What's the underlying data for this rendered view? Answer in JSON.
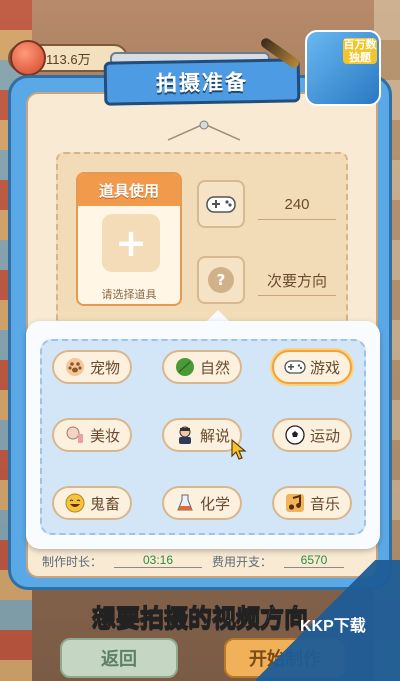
{
  "hud": {
    "coins": "113.6万"
  },
  "dialog": {
    "title": "拍摄准备",
    "item_card": {
      "header": "道具使用",
      "hint": "请选择道具"
    },
    "stats": [
      {
        "icon": "gamepad-icon",
        "value": "240"
      },
      {
        "icon": "question-icon",
        "value": "次要方向"
      }
    ]
  },
  "genres": [
    {
      "label": "宠物",
      "icon": "paw-icon"
    },
    {
      "label": "自然",
      "icon": "leaf-icon"
    },
    {
      "label": "游戏",
      "icon": "gamepad-icon",
      "selected": true
    },
    {
      "label": "美妆",
      "icon": "makeup-icon"
    },
    {
      "label": "解说",
      "icon": "commentator-icon"
    },
    {
      "label": "运动",
      "icon": "soccer-ball-icon"
    },
    {
      "label": "鬼畜",
      "icon": "laughing-face-icon"
    },
    {
      "label": "化学",
      "icon": "flask-icon"
    },
    {
      "label": "音乐",
      "icon": "music-note-icon"
    }
  ],
  "footer": {
    "duration_label": "制作时长：",
    "duration_value": "03:16",
    "cost_label": "费用开支：",
    "cost_value": "6570"
  },
  "prompt": "想要拍摄的视频方向",
  "buttons": {
    "back": "返回",
    "start": "开始制作"
  },
  "badge_text": "百万数独题",
  "watermark_text": "KKP下载",
  "colors": {
    "panel_blue": "#5aa9e6",
    "accent_orange": "#f19a4c",
    "selected_glow": "#ffd27a"
  }
}
